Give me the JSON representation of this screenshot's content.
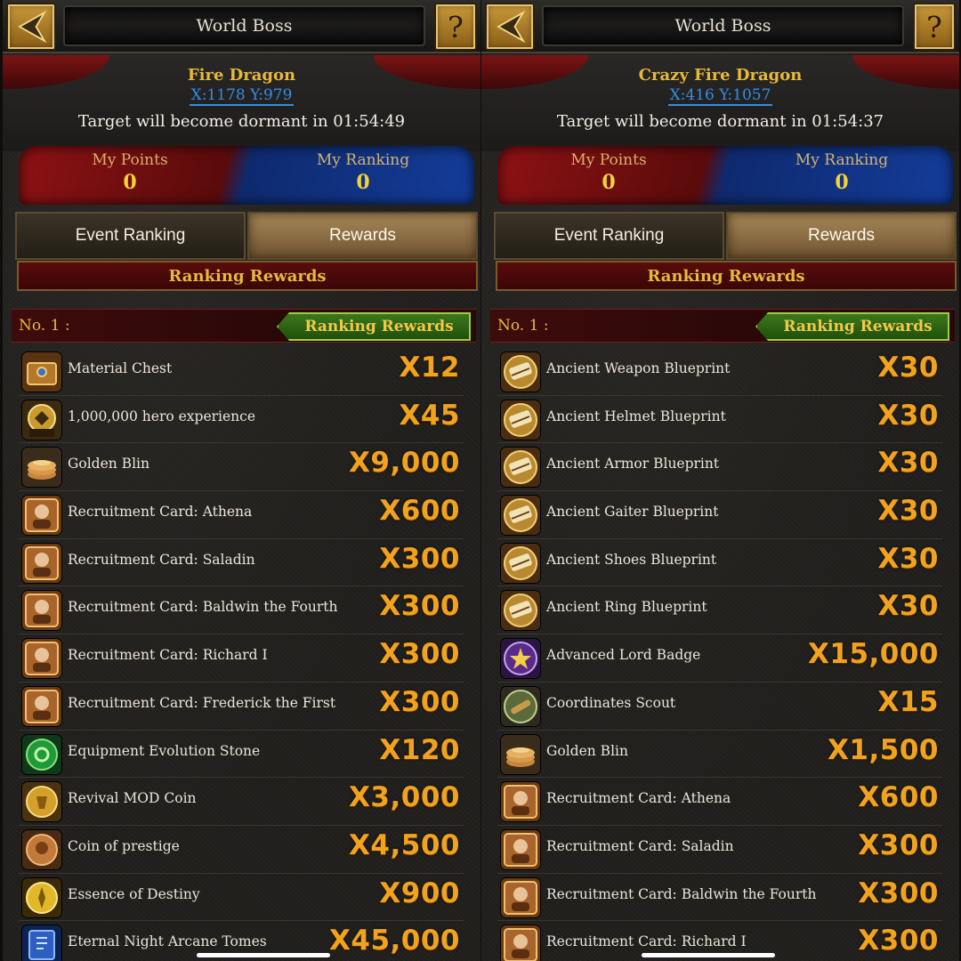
{
  "panels": [
    {
      "title": "World Boss",
      "help_label": "?",
      "boss_name": "Fire Dragon",
      "coords": "X:1178 Y:979",
      "dormant_text": "Target will become dormant in 01:54:49",
      "points_label": "My Points",
      "points_value": "0",
      "ranking_label": "My Ranking",
      "ranking_value": "0",
      "tabs": {
        "event": "Event Ranking",
        "rewards": "Rewards"
      },
      "section_title": "Ranking Rewards",
      "rank_label": "No. 1 :",
      "rank_button": "Ranking Rewards",
      "items": [
        {
          "name": "Material Chest",
          "qty": "X12",
          "icon": "chest-icon"
        },
        {
          "name": "1,000,000 hero experience",
          "qty": "X45",
          "icon": "exp-icon"
        },
        {
          "name": "Golden Blin",
          "qty": "X9,000",
          "icon": "pancake-icon"
        },
        {
          "name": "Recruitment Card: Athena",
          "qty": "X600",
          "icon": "card-icon"
        },
        {
          "name": "Recruitment Card: Saladin",
          "qty": "X300",
          "icon": "card-icon"
        },
        {
          "name": "Recruitment Card: Baldwin the Fourth",
          "qty": "X300",
          "icon": "card-icon"
        },
        {
          "name": "Recruitment Card: Richard I",
          "qty": "X300",
          "icon": "card-icon"
        },
        {
          "name": "Recruitment Card: Frederick the First",
          "qty": "X300",
          "icon": "card-icon"
        },
        {
          "name": "Equipment Evolution Stone",
          "qty": "X120",
          "icon": "stone-icon"
        },
        {
          "name": "Revival MOD Coin",
          "qty": "X3,000",
          "icon": "coin-icon"
        },
        {
          "name": "Coin of prestige",
          "qty": "X4,500",
          "icon": "prestige-coin-icon"
        },
        {
          "name": "Essence of Destiny",
          "qty": "X900",
          "icon": "essence-icon"
        },
        {
          "name": "Eternal Night Arcane Tomes",
          "qty": "X45,000",
          "icon": "tome-icon"
        }
      ]
    },
    {
      "title": "World Boss",
      "help_label": "?",
      "boss_name": "Crazy Fire Dragon",
      "coords": "X:416 Y:1057",
      "dormant_text": "Target will become dormant in 01:54:37",
      "points_label": "My Points",
      "points_value": "0",
      "ranking_label": "My Ranking",
      "ranking_value": "0",
      "tabs": {
        "event": "Event Ranking",
        "rewards": "Rewards"
      },
      "section_title": "Ranking Rewards",
      "rank_label": "No. 1 :",
      "rank_button": "Ranking Rewards",
      "items": [
        {
          "name": "Ancient Weapon Blueprint",
          "qty": "X30",
          "icon": "blueprint-icon"
        },
        {
          "name": "Ancient Helmet Blueprint",
          "qty": "X30",
          "icon": "blueprint-icon"
        },
        {
          "name": "Ancient Armor Blueprint",
          "qty": "X30",
          "icon": "blueprint-icon"
        },
        {
          "name": "Ancient Gaiter Blueprint",
          "qty": "X30",
          "icon": "blueprint-icon"
        },
        {
          "name": "Ancient Shoes Blueprint",
          "qty": "X30",
          "icon": "blueprint-icon"
        },
        {
          "name": "Ancient Ring Blueprint",
          "qty": "X30",
          "icon": "blueprint-icon"
        },
        {
          "name": "Advanced Lord Badge",
          "qty": "X15,000",
          "icon": "badge-icon"
        },
        {
          "name": "Coordinates Scout",
          "qty": "X15",
          "icon": "scout-icon"
        },
        {
          "name": "Golden Blin",
          "qty": "X1,500",
          "icon": "pancake-icon"
        },
        {
          "name": "Recruitment Card: Athena",
          "qty": "X600",
          "icon": "card-icon"
        },
        {
          "name": "Recruitment Card: Saladin",
          "qty": "X300",
          "icon": "card-icon"
        },
        {
          "name": "Recruitment Card: Baldwin the Fourth",
          "qty": "X300",
          "icon": "card-icon"
        },
        {
          "name": "Recruitment Card: Richard I",
          "qty": "X300",
          "icon": "card-icon"
        }
      ]
    }
  ]
}
